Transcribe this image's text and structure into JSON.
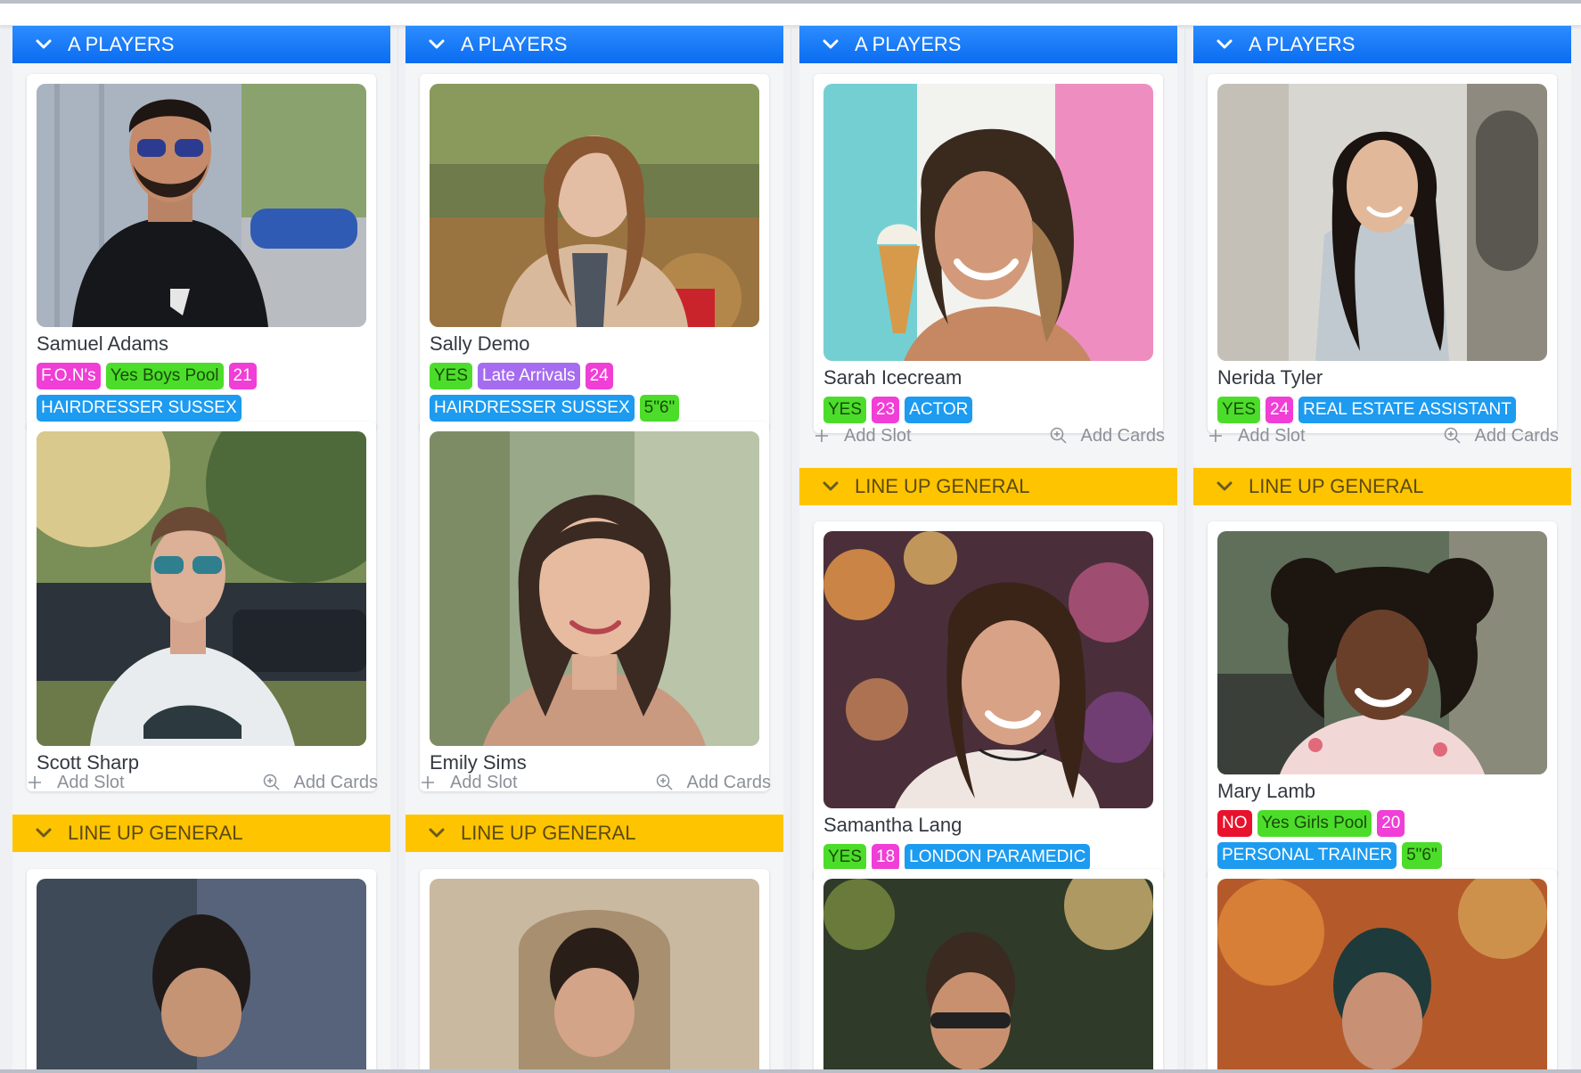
{
  "groups": {
    "a_players": "A PLAYERS",
    "line_up_general": "LINE UP GENERAL"
  },
  "actions": {
    "add_slot": "Add Slot",
    "add_cards": "Add Cards"
  },
  "columns": [
    {
      "cards": [
        {
          "name": "Samuel Adams",
          "tags": [
            "F.O.N's",
            "Yes Boys Pool",
            "21",
            "HAIRDRESSER SUSSEX"
          ],
          "tag_colors": [
            "magenta",
            "green",
            "magenta",
            "blue"
          ]
        },
        {
          "name": "Scott Sharp",
          "tags": [],
          "tag_colors": []
        }
      ]
    },
    {
      "cards": [
        {
          "name": "Sally Demo",
          "tags": [
            "YES",
            "Late Arrivals",
            "24",
            "HAIRDRESSER SUSSEX",
            "5\"6\""
          ],
          "tag_colors": [
            "green",
            "purple",
            "magenta",
            "blue",
            "green"
          ]
        },
        {
          "name": "Emily Sims",
          "tags": [],
          "tag_colors": []
        }
      ]
    },
    {
      "cards": [
        {
          "name": "Sarah Icecream",
          "tags": [
            "YES",
            "23",
            "ACTOR"
          ],
          "tag_colors": [
            "green",
            "magenta",
            "blue"
          ]
        },
        {
          "name": "Samantha Lang",
          "tags": [
            "YES",
            "18",
            "LONDON PARAMEDIC"
          ],
          "tag_colors": [
            "green",
            "magenta",
            "blue"
          ]
        }
      ]
    },
    {
      "cards": [
        {
          "name": "Nerida Tyler",
          "tags": [
            "YES",
            "24",
            "REAL ESTATE ASSISTANT"
          ],
          "tag_colors": [
            "green",
            "magenta",
            "blue"
          ]
        },
        {
          "name": "Mary Lamb",
          "tags": [
            "NO",
            "Yes Girls Pool",
            "20",
            "PERSONAL TRAINER",
            "5\"6\""
          ],
          "tag_colors": [
            "red",
            "green",
            "magenta",
            "blue",
            "green"
          ]
        }
      ]
    }
  ],
  "colors": {
    "header_blue": "#0a6cf0",
    "header_gold": "#ffc400",
    "tag_magenta": "#f03ed6",
    "tag_green": "#4cdd2a",
    "tag_purple": "#a56cf0",
    "tag_blue": "#1d9bf0",
    "tag_red": "#e8122d"
  },
  "icons": [
    "chevron-down-icon",
    "plus-icon",
    "zoom-in-icon"
  ]
}
